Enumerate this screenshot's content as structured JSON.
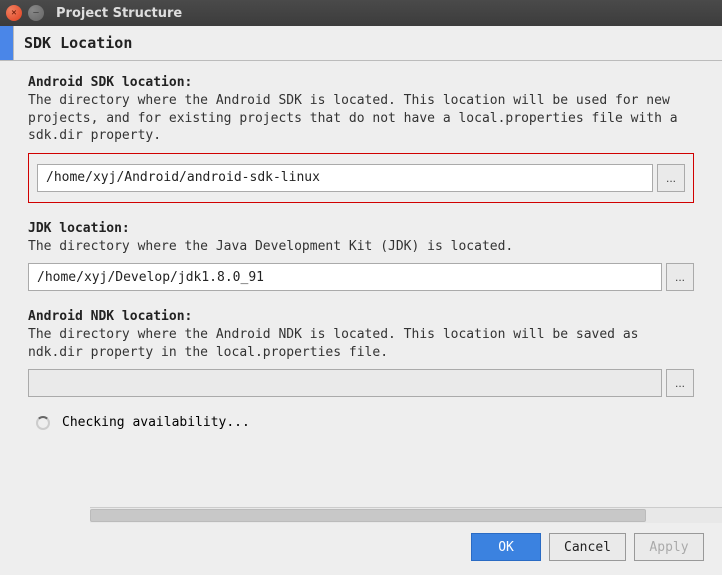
{
  "window": {
    "title": "Project Structure"
  },
  "page": {
    "heading": "SDK Location"
  },
  "sections": {
    "android_sdk": {
      "title": "Android SDK location:",
      "desc": "The directory where the Android SDK is located. This location will be used for new projects, and for existing projects that do not have a local.properties file with a sdk.dir property.",
      "value": "/home/xyj/Android/android-sdk-linux",
      "browse": "..."
    },
    "jdk": {
      "title": "JDK location:",
      "desc": "The directory where the Java Development Kit (JDK) is located.",
      "value": "/home/xyj/Develop/jdk1.8.0_91",
      "browse": "..."
    },
    "ndk": {
      "title": "Android NDK location:",
      "desc": "The directory where the Android NDK is located. This location will be saved as ndk.dir property in the local.properties file.",
      "value": "",
      "browse": "..."
    }
  },
  "status": {
    "checking": "Checking availability..."
  },
  "buttons": {
    "ok": "OK",
    "cancel": "Cancel",
    "apply": "Apply"
  }
}
